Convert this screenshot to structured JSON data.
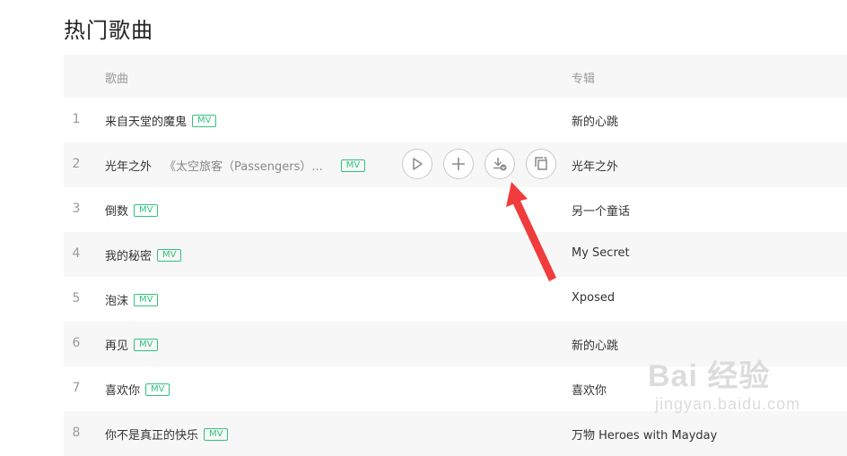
{
  "page_title": "热门歌曲",
  "headers": {
    "song": "歌曲",
    "album": "专辑"
  },
  "mv_label": "MV",
  "songs": [
    {
      "num": "1",
      "title": "来自天堂的魔鬼",
      "subtitle": "",
      "album": "新的心跳"
    },
    {
      "num": "2",
      "title": "光年之外",
      "subtitle": "《太空旅客（Passengers）...",
      "album": "光年之外"
    },
    {
      "num": "3",
      "title": "倒数",
      "subtitle": "",
      "album": "另一个童话"
    },
    {
      "num": "4",
      "title": "我的秘密",
      "subtitle": "",
      "album": "My Secret"
    },
    {
      "num": "5",
      "title": "泡沫",
      "subtitle": "",
      "album": "Xposed"
    },
    {
      "num": "6",
      "title": "再见",
      "subtitle": "",
      "album": "新的心跳"
    },
    {
      "num": "7",
      "title": "喜欢你",
      "subtitle": "",
      "album": "喜欢你"
    },
    {
      "num": "8",
      "title": "你不是真正的快乐",
      "subtitle": "",
      "album": "万物 Heroes with Mayday"
    }
  ],
  "hover_actions": [
    "play-icon",
    "add-icon",
    "download-icon",
    "share-icon"
  ],
  "annotation": {
    "color": "#f03c3c"
  },
  "watermark": {
    "logo": "Bai 经验",
    "url": "jingyan.baidu.com"
  },
  "colors": {
    "accent": "#31c27c",
    "row_alt": "#f7f7f7"
  }
}
